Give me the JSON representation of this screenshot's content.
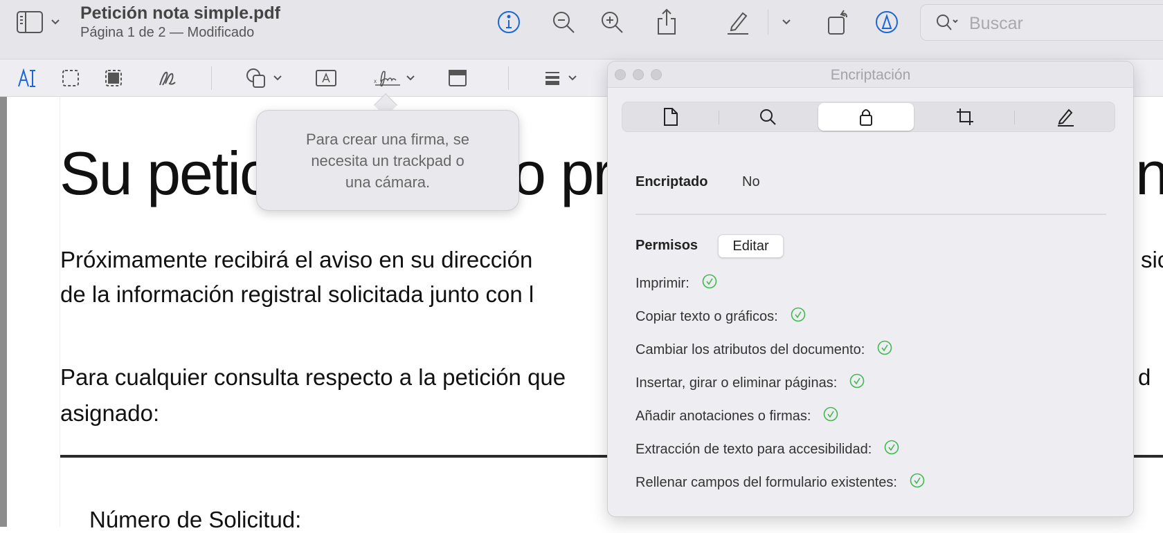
{
  "window": {
    "title": "Petición nota simple.pdf",
    "subtitle": "Página 1 de 2 — Modificado"
  },
  "toolbar": {
    "search_placeholder": "Buscar",
    "icons": [
      "sidebar-icon",
      "info-icon",
      "zoom-out-icon",
      "zoom-in-icon",
      "share-icon",
      "highlight-pen-icon",
      "rotate-icon",
      "markup-icon",
      "search-icon"
    ],
    "accent": "#1a66d6"
  },
  "markup_toolbar": {
    "icons": [
      "text-selection-icon",
      "rectangle-selection-icon",
      "smart-lasso-icon",
      "sketch-icon",
      "shapes-icon",
      "text-box-icon",
      "signature-icon",
      "note-icon",
      "shape-style-icon"
    ]
  },
  "document": {
    "heading_left": "Su petic",
    "heading_mid": "o pr",
    "heading_right": "nt",
    "p1_line1": "Próximamente recibirá el aviso en su dirección",
    "p1_line1_right": "sic",
    "p1_line2": "de la información registral solicitada junto con l",
    "p2_line1": "Para cualquier consulta respecto a la petición que",
    "p2_line1_right": "d",
    "p2_line2": "asignado:",
    "field_label": "Número de Solicitud:"
  },
  "tooltip": {
    "text_line1": "Para crear una firma, se",
    "text_line2": "necesita un trackpad o",
    "text_line3": "una cámara."
  },
  "inspector": {
    "title": "Encriptación",
    "tabs": [
      {
        "name": "general",
        "icon": "document-icon",
        "selected": false
      },
      {
        "name": "search",
        "icon": "magnifier-icon",
        "selected": false
      },
      {
        "name": "encryption",
        "icon": "lock-icon",
        "selected": true
      },
      {
        "name": "crop",
        "icon": "crop-icon",
        "selected": false
      },
      {
        "name": "annotations",
        "icon": "pencil-icon",
        "selected": false
      }
    ],
    "encrypted_label": "Encriptado",
    "encrypted_value": "No",
    "permissions_label": "Permisos",
    "edit_button": "Editar",
    "permissions": [
      {
        "label": "Imprimir:",
        "allowed": true
      },
      {
        "label": "Copiar texto o gráficos:",
        "allowed": true
      },
      {
        "label": "Cambiar los atributos del documento:",
        "allowed": true
      },
      {
        "label": "Insertar, girar o eliminar páginas:",
        "allowed": true
      },
      {
        "label": "Añadir anotaciones o firmas:",
        "allowed": true
      },
      {
        "label": "Extracción de texto para accesibilidad:",
        "allowed": true
      },
      {
        "label": "Rellenar campos del formulario existentes:",
        "allowed": true
      }
    ],
    "check_color": "#3fb950"
  }
}
